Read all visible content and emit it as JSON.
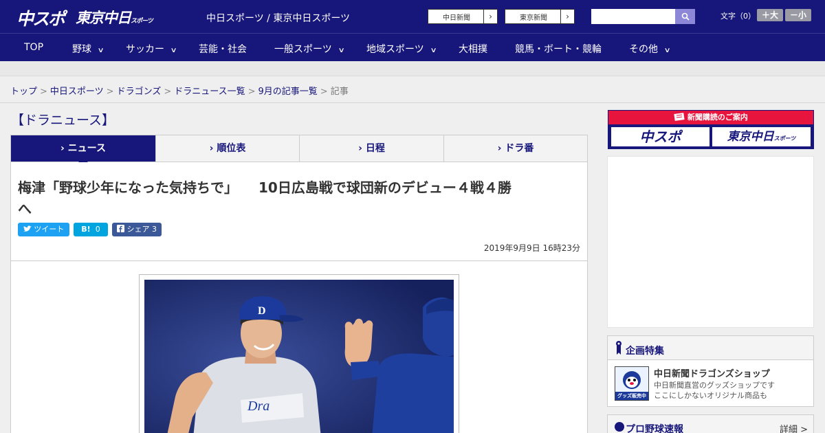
{
  "header": {
    "logo_primary": "中スポ",
    "logo_secondary": "東京中日",
    "logo_secondary_small": "スポーツ",
    "title": "中日スポーツ / 東京中日スポーツ",
    "buttons": [
      {
        "label": "中日新聞",
        "arrow": "›"
      },
      {
        "label": "東京新聞",
        "arrow": "›"
      }
    ],
    "search_placeholder": "",
    "fontsize_label": "文字（0）",
    "font_large": "＋大",
    "font_small": "－小"
  },
  "nav": {
    "items": [
      {
        "label": "TOP",
        "has_dropdown": false
      },
      {
        "label": "野球",
        "has_dropdown": true
      },
      {
        "label": "サッカー",
        "has_dropdown": true
      },
      {
        "label": "芸能・社会",
        "has_dropdown": false
      },
      {
        "label": "一般スポーツ",
        "has_dropdown": true
      },
      {
        "label": "地域スポーツ",
        "has_dropdown": true
      },
      {
        "label": "大相撲",
        "has_dropdown": false
      },
      {
        "label": "競馬・ボート・競輪",
        "has_dropdown": false
      },
      {
        "label": "その他",
        "has_dropdown": true
      }
    ],
    "chevron": "∨"
  },
  "breadcrumb": {
    "links": [
      "トップ",
      "中日スポーツ",
      "ドラゴンズ",
      "ドラニュース一覧",
      "9月の記事一覧"
    ],
    "current": "記事",
    "separator": ">"
  },
  "section": {
    "title": "【ドラニュース】",
    "tabs": [
      {
        "label": "ニュース",
        "active": true
      },
      {
        "label": "順位表",
        "active": false
      },
      {
        "label": "日程",
        "active": false
      },
      {
        "label": "ドラ番",
        "active": false
      }
    ],
    "tab_prefix": "›"
  },
  "article": {
    "headline_line1": "梅津「野球少年になった気持ちで」　　10日広島戦で球団新のデビュー４戦４勝",
    "headline_line2": "へ",
    "share": {
      "tweet_label": "ツイート",
      "hatena_label": "B!",
      "hatena_count": "0",
      "facebook_label": "シェア",
      "facebook_count": "3"
    },
    "date": "2019年9月9日 16時23分"
  },
  "sidebar": {
    "subscription_label": "新聞購読のご案内",
    "sub_logo1": "中スポ",
    "sub_logo2": "東京中日",
    "sub_logo2_small": "スポーツ",
    "feature_title": "企画特集",
    "shop_title": "中日新聞ドラゴンズショップ",
    "shop_desc1": "中日新聞直営のグッズショップです",
    "shop_desc2": "ここにしかないオリジナル商品も",
    "shop_badge": "グッズ販売中",
    "pro_title": "プロ野球速報",
    "pro_detail": "詳細 >"
  },
  "colors": {
    "brand_navy": "#17167a",
    "accent_red": "#e7153e",
    "twitter": "#1da1f2",
    "hatena": "#00a4de",
    "facebook": "#3b5998"
  }
}
